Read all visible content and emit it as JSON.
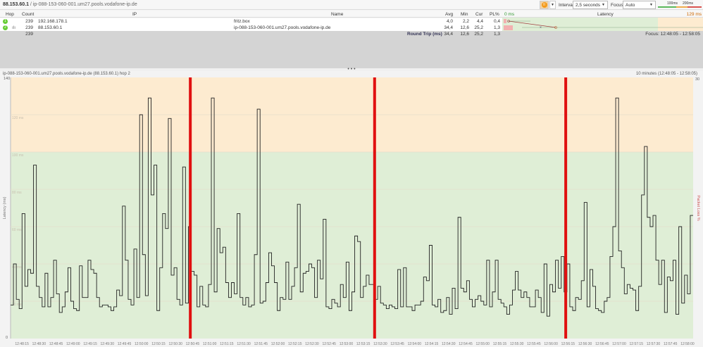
{
  "titlebar": {
    "target": "88.153.60.1",
    "separator": " / ",
    "hostname": "ip-088-153-060-001.um27.pools.vodafone-ip.de"
  },
  "toolbar": {
    "pause_icon": "pause-icon",
    "interval_label": "Interval",
    "interval_value": "2,5 seconds",
    "focus_label": "Focus",
    "focus_value": "Auto",
    "scale_100": "100ms",
    "scale_200": "200ms",
    "colors": {
      "good": "#5cb85c",
      "warn": "#f0ad4e",
      "bad": "#d9534f"
    }
  },
  "table": {
    "headers": {
      "hop": "Hop",
      "count": "Count",
      "ip": "IP",
      "name": "Name",
      "avg": "Avg",
      "min": "Min",
      "cur": "Cur",
      "pl": "PL%",
      "latency": "Latency",
      "lat_min": "0 ms",
      "lat_max": "129 ms"
    },
    "rows": [
      {
        "hop": "1",
        "count": "239",
        "ip": "192.168.178.1",
        "name": "fritz.box",
        "avg": "4,0",
        "min": "2,2",
        "cur": "4,4",
        "pl": "0,4"
      },
      {
        "hop": "2",
        "count": "239",
        "ip": "88.153.60.1",
        "name": "ip-088-153-060-001.um27.pools.vodafone-ip.de",
        "avg": "34,4",
        "min": "12,6",
        "cur": "25,2",
        "pl": "1,3"
      }
    ],
    "summary": {
      "count": "239",
      "label": "Round Trip (ms)",
      "avg": "34,4",
      "min": "12,6",
      "cur": "25,2",
      "pl": "1,3",
      "focus": "Focus: 12:48:05 - 12:58:05"
    }
  },
  "splitter": "• • •",
  "graph": {
    "title": "ip-088-153-060-001.um27.pools.vodafone-ip.de (88.153.60.1) hop 2",
    "range": "10 minutes (12:48:05 - 12:58:05)"
  },
  "chart_data": {
    "type": "line",
    "title": "ip-088-153-060-001.um27.pools.vodafone-ip.de (88.153.60.1) hop 2",
    "ylabel": "Latency (ms)",
    "y2label": "Packet Loss %",
    "ylim": [
      0,
      140
    ],
    "y2lim": [
      0,
      30
    ],
    "y_ticks": [
      "0",
      "20 ms",
      "40 ms",
      "60 ms",
      "80 ms",
      "100 ms",
      "120 ms",
      "140"
    ],
    "y_tick_values": [
      0,
      20,
      40,
      60,
      80,
      100,
      120,
      140
    ],
    "y2_ticks": [
      "30"
    ],
    "thresholds": {
      "warn_ms": 100,
      "colors": {
        "good": "#dfeed6",
        "warn": "#fdebd0",
        "loss": "#e01010"
      }
    },
    "x_start": "12:48:05",
    "x_end": "12:58:05",
    "x_seconds": 600,
    "x_ticks": [
      "12:48:15",
      "12:48:30",
      "12:48:45",
      "12:49:00",
      "12:49:15",
      "12:49:30",
      "12:49:45",
      "12:50:00",
      "12:50:15",
      "12:50:30",
      "12:50:45",
      "12:51:00",
      "12:51:15",
      "12:51:30",
      "12:51:45",
      "12:52:00",
      "12:52:15",
      "12:52:30",
      "12:52:45",
      "12:53:00",
      "12:53:15",
      "12:53:30",
      "12:53:45",
      "12:54:00",
      "12:54:15",
      "12:54:30",
      "12:54:45",
      "12:55:00",
      "12:55:15",
      "12:55:30",
      "12:55:45",
      "12:56:00",
      "12:56:15",
      "12:56:30",
      "12:56:45",
      "12:57:00",
      "12:57:15",
      "12:57:30",
      "12:57:45",
      "12:58:00"
    ],
    "packet_loss_seconds": [
      158,
      320,
      488
    ],
    "values": [
      18,
      40,
      21,
      16,
      67,
      28,
      37,
      35,
      93,
      28,
      22,
      17,
      35,
      17,
      22,
      42,
      24,
      14,
      17,
      25,
      38,
      20,
      16,
      15,
      39,
      22,
      22,
      42,
      37,
      35,
      22,
      17,
      18,
      18,
      17,
      15,
      17,
      26,
      23,
      71,
      42,
      21,
      18,
      48,
      22,
      120,
      45,
      23,
      129,
      77,
      93,
      15,
      38,
      67,
      59,
      118,
      34,
      38,
      21,
      18,
      92,
      19,
      60,
      36,
      34,
      17,
      28,
      18,
      17,
      29,
      129,
      25,
      59,
      46,
      49,
      30,
      22,
      30,
      24,
      67,
      22,
      18,
      22,
      17,
      18,
      45,
      123,
      19,
      20,
      30,
      46,
      39,
      30,
      15,
      22,
      21,
      41,
      21,
      28,
      38,
      72,
      25,
      35,
      36,
      40,
      38,
      22,
      42,
      32,
      64,
      17,
      16,
      21,
      19,
      17,
      29,
      22,
      41,
      15,
      25,
      55,
      52,
      22,
      28,
      34,
      29,
      29,
      21,
      28,
      19,
      18,
      16,
      18,
      17,
      16,
      37,
      17,
      38,
      17,
      17,
      15,
      18,
      18,
      20,
      33,
      31,
      50,
      18,
      17,
      21,
      14,
      15,
      22,
      13,
      27,
      16,
      65,
      27,
      25,
      31,
      21,
      17,
      21,
      23,
      20,
      18,
      42,
      17,
      25,
      42,
      21,
      19,
      17,
      13,
      18,
      26,
      36,
      26,
      22,
      25,
      22,
      17,
      17,
      26,
      22,
      14,
      40,
      12,
      29,
      25,
      42,
      27,
      44,
      25,
      40,
      17,
      15,
      22,
      21,
      31,
      73,
      17,
      37,
      28,
      16,
      15,
      14,
      20,
      22,
      44,
      60,
      129,
      47,
      38,
      24,
      29,
      27,
      26,
      15,
      28,
      77,
      103,
      65,
      60,
      66,
      42,
      29,
      42,
      14,
      33,
      31,
      42,
      13,
      60,
      19,
      34,
      24,
      66
    ]
  }
}
